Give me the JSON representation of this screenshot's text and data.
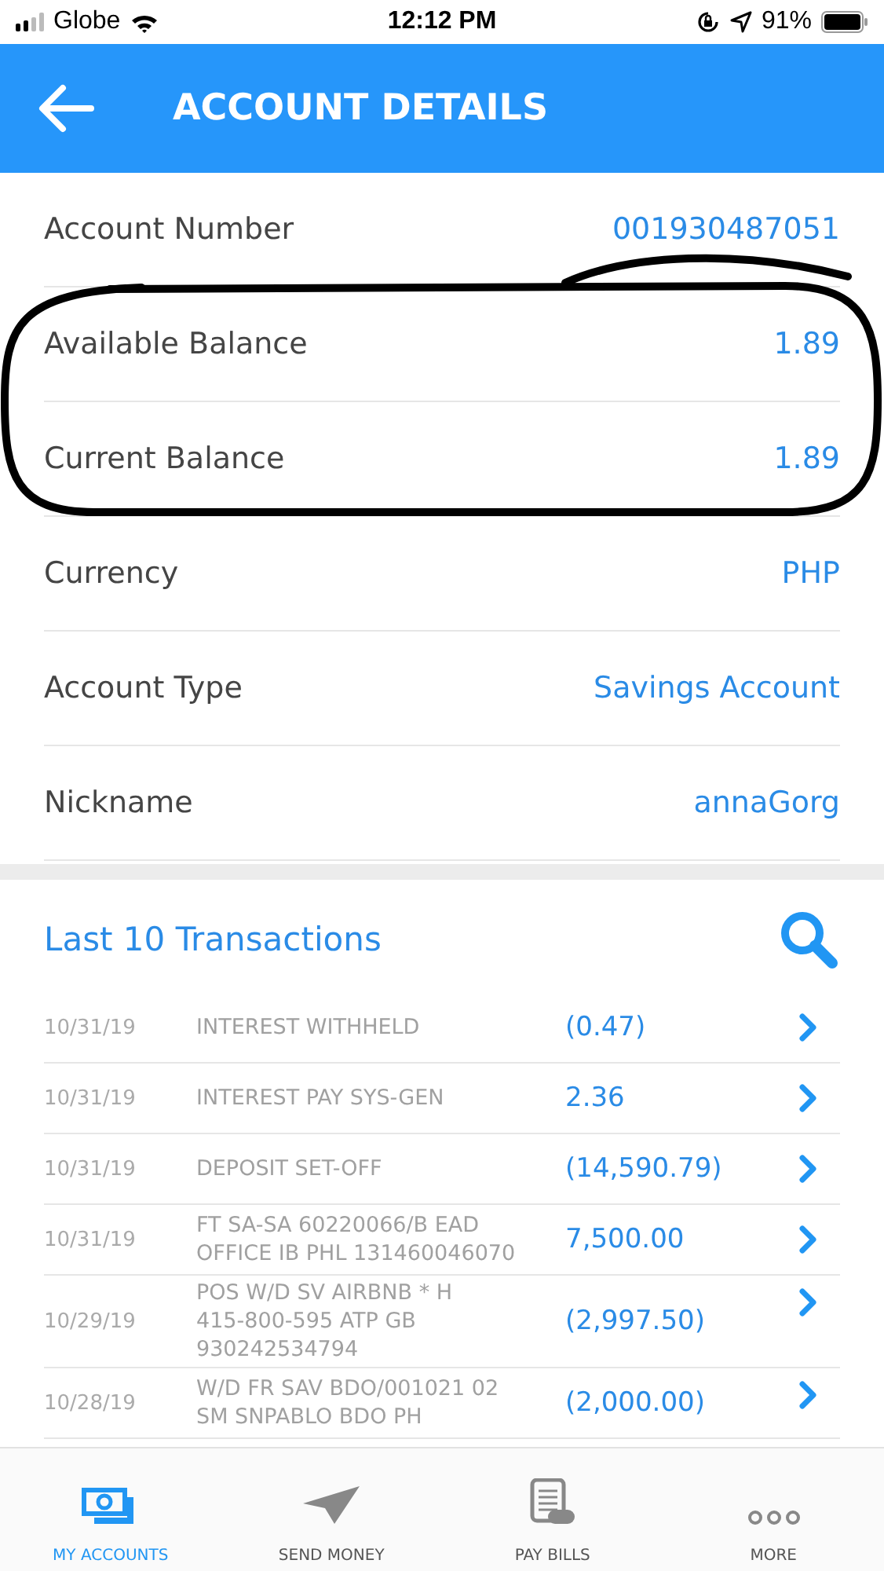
{
  "status_bar": {
    "carrier": "Globe",
    "time": "12:12 PM",
    "battery": "91%"
  },
  "header": {
    "title": "ACCOUNT DETAILS"
  },
  "details": [
    {
      "label": "Account Number",
      "value": "001930487051"
    },
    {
      "label": "Available Balance",
      "value": "1.89"
    },
    {
      "label": "Current Balance",
      "value": "1.89"
    },
    {
      "label": "Currency",
      "value": "PHP"
    },
    {
      "label": "Account Type",
      "value": "Savings Account"
    },
    {
      "label": "Nickname",
      "value": "annaGorg"
    }
  ],
  "transactions": {
    "title": "Last 10 Transactions",
    "rows": [
      {
        "date": "10/31/19",
        "description": [
          "INTEREST WITHHELD"
        ],
        "amount": "(0.47)"
      },
      {
        "date": "10/31/19",
        "description": [
          "INTEREST PAY SYS-GEN"
        ],
        "amount": "2.36"
      },
      {
        "date": "10/31/19",
        "description": [
          "DEPOSIT SET-OFF"
        ],
        "amount": "(14,590.79)"
      },
      {
        "date": "10/31/19",
        "description": [
          "FT SA-SA 60220066/B EAD",
          "OFFICE IB PHL  131460046070"
        ],
        "amount": "7,500.00"
      },
      {
        "date": "10/29/19",
        "description": [
          "POS W/D SV AIRBNB * H",
          "415-800-595 ATP GB",
          "930242534794"
        ],
        "amount": "(2,997.50)"
      },
      {
        "date": "10/28/19",
        "description": [
          "W/D FR SAV BDO/001021 02",
          "SM SNPABLO BDO PH"
        ],
        "amount": "(2,000.00)"
      }
    ]
  },
  "tab_bar": [
    {
      "label": "MY ACCOUNTS",
      "kind": "accounts",
      "selected": true
    },
    {
      "label": "SEND MONEY",
      "kind": "send",
      "selected": false
    },
    {
      "label": "PAY BILLS",
      "kind": "bills",
      "selected": false
    },
    {
      "label": "MORE",
      "kind": "more",
      "selected": false
    }
  ]
}
